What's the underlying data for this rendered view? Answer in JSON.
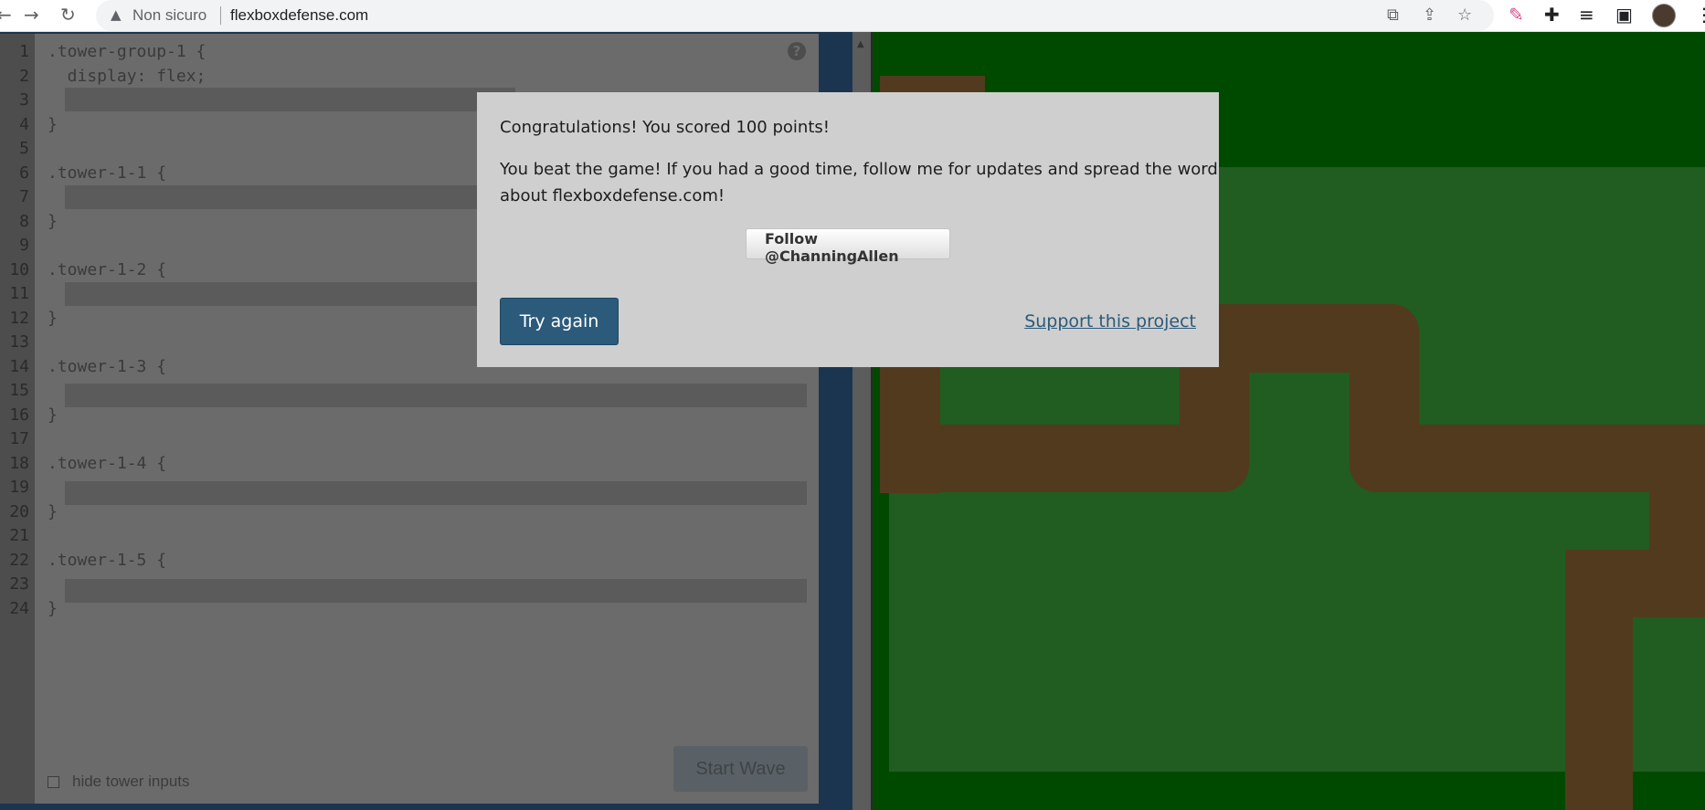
{
  "browser": {
    "back_glyph": "←",
    "forward_glyph": "→",
    "reload_glyph": "↻",
    "security_label": "Non sicuro",
    "url": "flexboxdefense.com",
    "icons": [
      "translate-icon",
      "share-icon",
      "bookmark-star-icon",
      "pen-extension-icon",
      "extensions-puzzle-icon",
      "media-queue-icon",
      "side-panel-icon",
      "profile-avatar",
      "menu-kebab-icon"
    ]
  },
  "editor": {
    "line_numbers": [
      "1",
      "2",
      "3",
      "4",
      "5",
      "6",
      "7",
      "8",
      "9",
      "10",
      "11",
      "12",
      "13",
      "14",
      "15",
      "16",
      "17",
      "18",
      "19",
      "20",
      "21",
      "22",
      "23",
      "24"
    ],
    "code_lines": {
      "l1": ".tower-group-1 {",
      "l2": "  display: flex;",
      "l4": "}",
      "l6": ".tower-1-1 {",
      "l8": "}",
      "l10": ".tower-1-2 {",
      "l12": "}",
      "l14": ".tower-1-3 {",
      "l16": "}",
      "l18": ".tower-1-4 {",
      "l20": "}",
      "l22": ".tower-1-5 {",
      "l24": "}"
    },
    "help_glyph": "?",
    "hide_inputs_label": "hide tower inputs",
    "start_wave_label": "Start Wave"
  },
  "modal": {
    "score_message": "Congratulations! You scored 100 points!",
    "beat_message_line1": "You beat the game! If you had a good time, follow me for updates and spread the word",
    "beat_message_line2": "about flexboxdefense.com!",
    "follow_button_label": "Follow @ChanningAllen",
    "try_again_label": "Try again",
    "support_link_label": "Support this project"
  },
  "colors": {
    "board_green": "#004a00",
    "path_brown": "#523a1e",
    "accent_blue": "#2b5a7a"
  }
}
